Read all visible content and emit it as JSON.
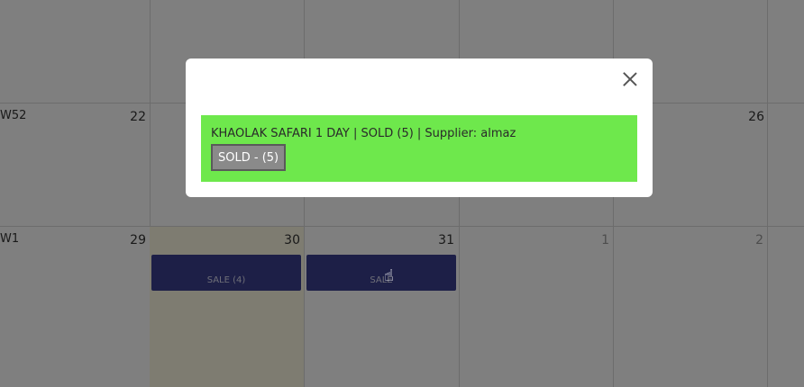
{
  "calendar": {
    "weeks": [
      {
        "label": "W52",
        "days": [
          "22",
          "26"
        ]
      },
      {
        "label": "W1",
        "days": [
          "29",
          "30",
          "31",
          "1",
          "2"
        ]
      }
    ],
    "events": [
      {
        "label": "SALE (4)"
      },
      {
        "label": "SALE"
      }
    ],
    "colors": {
      "event": "#3a3f8f",
      "today": "#fcf8e3"
    }
  },
  "modal": {
    "booking_text": "KHAOLAK SAFARI 1 DAY | SOLD (5) | Supplier: almaz",
    "status_button": "SOLD - (5)",
    "panel_color": "#6ee84c"
  }
}
